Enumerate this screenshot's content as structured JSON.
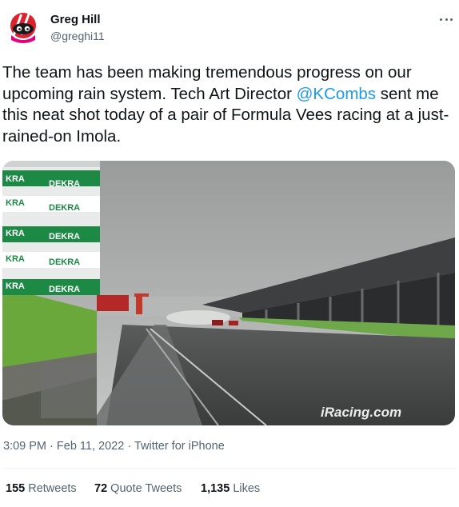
{
  "author": {
    "name": "Greg Hill",
    "handle": "@greghi11",
    "avatar_icon": "cartoon-helmet-avatar"
  },
  "more_icon": "more-dots-icon",
  "tweet": {
    "text_before": "The team has been making tremendous progress on our upcoming rain system. Tech Art Director ",
    "mention": "@KCombs",
    "text_after": " sent me this neat shot today of a pair of Formula Vees racing at a just-rained-on Imola."
  },
  "media": {
    "sign_rows": [
      "KRA",
      "DEKRA",
      "KRA",
      "DEKRA",
      "KRA",
      "DEKRA",
      "KRA",
      "DEKRA",
      "KRA",
      "DEKRA"
    ],
    "watermark": "iRacing.com"
  },
  "meta": {
    "time": "3:09 PM",
    "date": "Feb 11, 2022",
    "separator": "·",
    "source": "Twitter for iPhone"
  },
  "stats": {
    "retweets_count": "155",
    "retweets_label": "Retweets",
    "quotes_count": "72",
    "quotes_label": "Quote Tweets",
    "likes_count": "1,135",
    "likes_label": "Likes"
  },
  "colors": {
    "accent": "#1d9bf0",
    "text": "#0f1419",
    "muted": "#536471",
    "dekra_green": "#1c8a45"
  }
}
